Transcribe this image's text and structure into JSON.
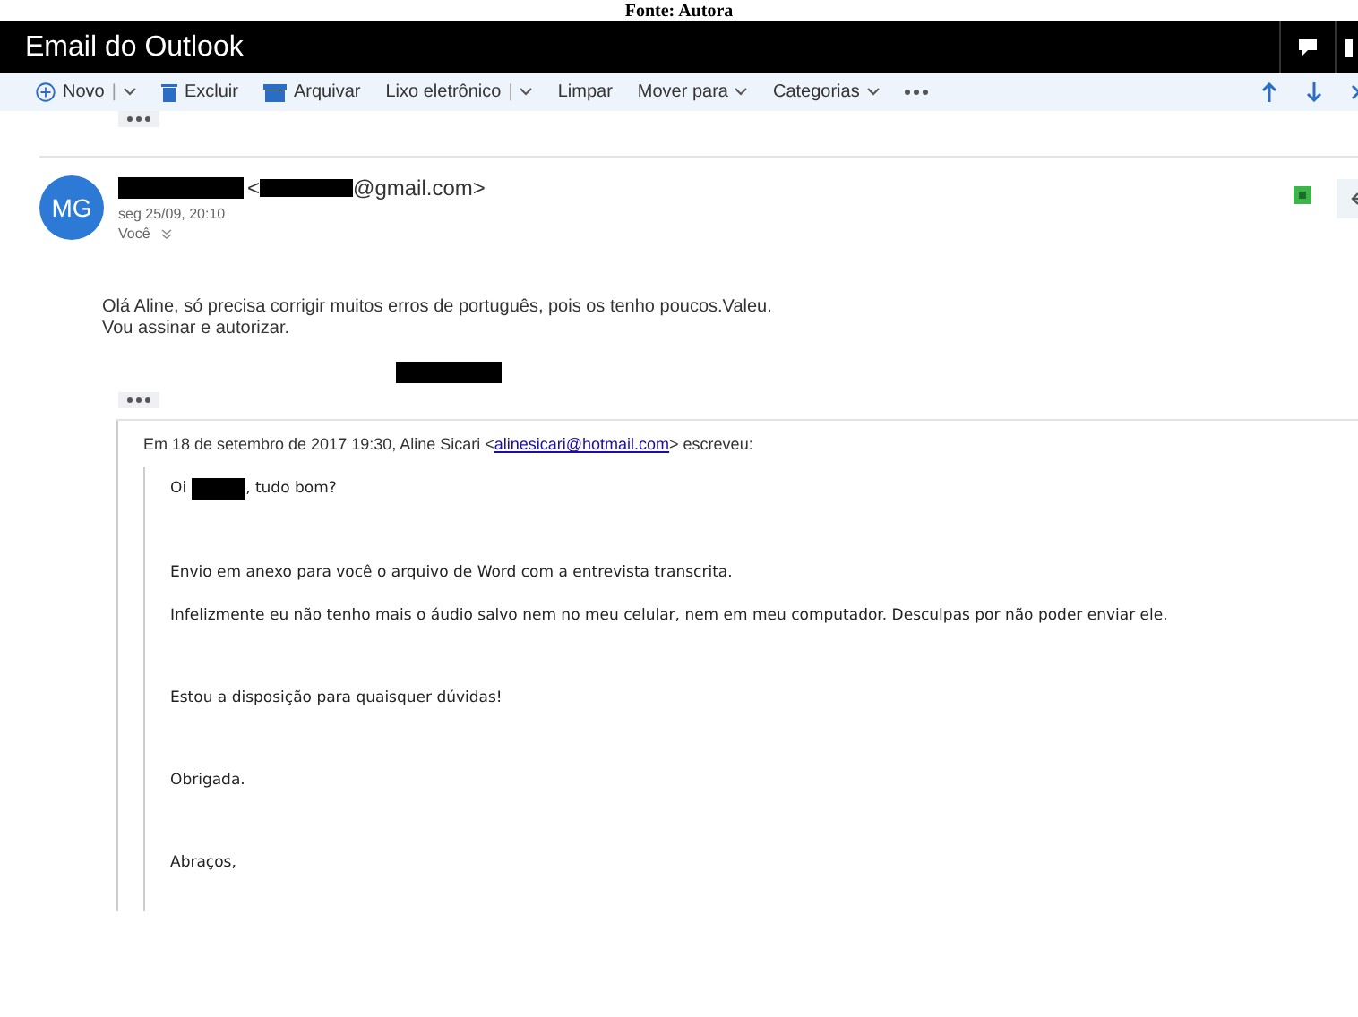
{
  "caption": "Fonte: Autora",
  "app": {
    "title": "Email do Outlook"
  },
  "toolbar": [
    {
      "label": "Novo",
      "separator": "|",
      "menu": true
    },
    {
      "label": "Excluir",
      "menu": false
    },
    {
      "label": "Arquivar",
      "menu": false
    },
    {
      "label": "Lixo eletrônico",
      "separator": "|",
      "menu": true
    },
    {
      "label": "Limpar",
      "menu": false
    },
    {
      "label": "Mover para",
      "menu": true
    },
    {
      "label": "Categorias",
      "menu": true
    }
  ],
  "message": {
    "initials": "MG",
    "address_open": "<",
    "address_end": "@gmail.com>",
    "date": "seg 25/09, 20:10",
    "recipient": "Você",
    "body": [
      "Olá Aline, só precisa corrigir muitos erros de português, pois os tenho poucos.Valeu.",
      "Vou assinar e autorizar."
    ]
  },
  "quote": {
    "intro": "Em 18 de setembro de 2017 19:30, Aline Sicari <",
    "email": "alinesicari@hotmail.com",
    "outro": "> escreveu:",
    "greeting_start": "Oi",
    "greeting_end": ", tudo bom?",
    "paragraphs": [
      "Envio em anexo para você o arquivo de Word com a entrevista transcrita.",
      "Infelizmente eu não tenho mais o áudio salvo nem no meu celular, nem em meu computador. Desculpas por não poder enviar ele.",
      "Estou a disposição para quaisquer dúvidas!",
      "Obrigada.",
      "Abraços,"
    ]
  }
}
